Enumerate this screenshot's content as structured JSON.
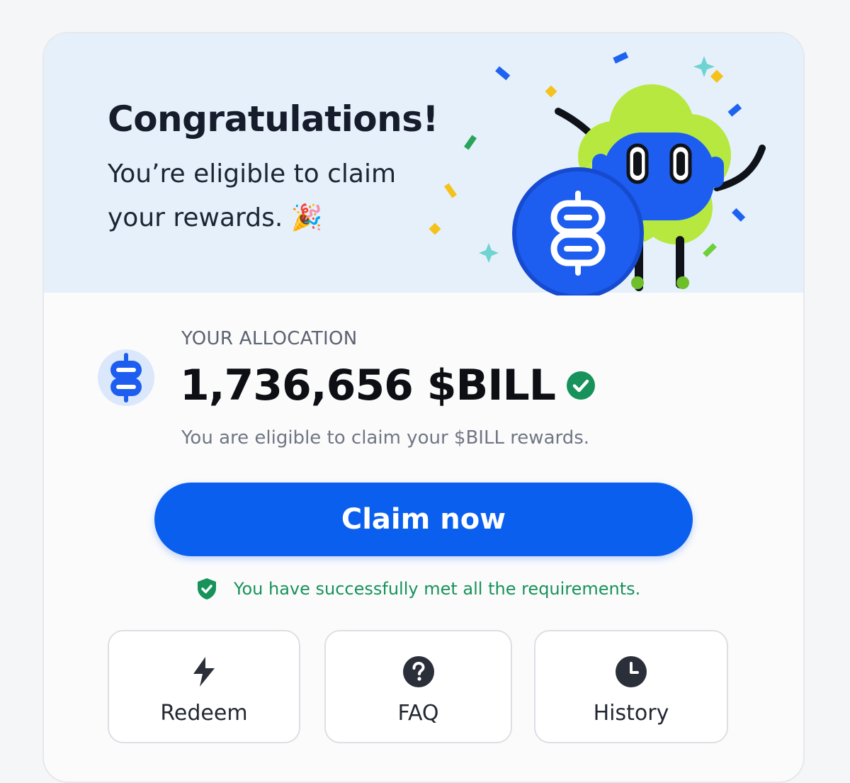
{
  "hero": {
    "title": "Congratulations!",
    "subtitle": "You’re eligible to claim your rewards. 🎉"
  },
  "allocation": {
    "label": "YOUR ALLOCATION",
    "amount": "1,736,656 $BILL",
    "note": "You are eligible to claim your $BILL rewards."
  },
  "claim": {
    "button_label": "Claim now"
  },
  "requirements": {
    "status_text": "You have successfully met all the requirements."
  },
  "actions": [
    {
      "label": "Redeem",
      "icon": "lightning-icon"
    },
    {
      "label": "FAQ",
      "icon": "question-icon"
    },
    {
      "label": "History",
      "icon": "clock-icon"
    }
  ],
  "colors": {
    "accent": "#0b5fef",
    "hero_background": "#e5f0fb",
    "success": "#17925a",
    "mascot_green": "#b6e83f"
  }
}
